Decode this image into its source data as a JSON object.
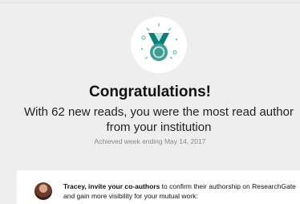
{
  "award": {
    "icon": "medal-icon",
    "colors": {
      "ribbon": "#0a7f7a",
      "medal": "#3f9d95",
      "accent": "#bfe6df",
      "decor": "#6cc3b8"
    }
  },
  "title": "Congratulations!",
  "message": "With 62 new reads, you were the most read author from your institution",
  "achieved": "Achieved week ending May 14, 2017",
  "invite": {
    "bold_text": "Tracey, invite your co-authors",
    "rest_text": " to confirm their authorship on ResearchGate and gain more visibility for your mutual work:"
  }
}
